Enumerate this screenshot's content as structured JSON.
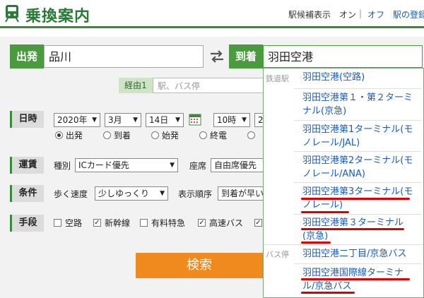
{
  "header": {
    "title": "乗換案内",
    "station_candidates_label": "駅候補表示",
    "on": "オン",
    "sep": "|",
    "off": "オフ",
    "register_link": "駅の登録"
  },
  "stations": {
    "from_label": "出発",
    "from_value": "品川",
    "to_label": "到着",
    "to_value": "羽田空港",
    "via_label": "経由1",
    "via_placeholder": "駅、バス停"
  },
  "datetime": {
    "label": "日時",
    "year": "2020年",
    "month": "3月",
    "day": "14日",
    "hour": "10時",
    "minute_partial": "2",
    "options": [
      "出発",
      "到着",
      "始発",
      "終電"
    ],
    "selected": "出発"
  },
  "fare": {
    "label": "運賃",
    "type_label": "種別",
    "type_value": "ICカード優先",
    "seat_label": "座席",
    "seat_value": "自由席優先"
  },
  "conditions": {
    "label": "条件",
    "walk_label": "歩く速度",
    "walk_value": "少しゆっくり",
    "order_label": "表示順序",
    "order_value": "到着が早い"
  },
  "means": {
    "label": "手段",
    "items": [
      {
        "label": "空路",
        "checked": false
      },
      {
        "label": "新幹線",
        "checked": true
      },
      {
        "label": "有料特急",
        "checked": false
      },
      {
        "label": "高速バス",
        "checked": true
      }
    ]
  },
  "search_button": "検索",
  "dropdown": {
    "rail_category": "鉄道駅",
    "bus_category": "バス停",
    "rail_items": [
      {
        "line1": "羽田空港(空路)",
        "line2": ""
      },
      {
        "line1": "羽田空港第１・第２ターミ",
        "line2": "ナル(京急)"
      },
      {
        "line1": "羽田空港第1ターミナル(モ",
        "line2": "ノレール/JAL)"
      },
      {
        "line1": "羽田空港第2ターミナル(モ",
        "line2": "ノレール/ANA)"
      },
      {
        "line1": "羽田空港第3ターミナル(モ",
        "line2": "ノレール)"
      },
      {
        "line1": "羽田空港第３ターミナル",
        "line2": "(京急)"
      }
    ],
    "bus_items": [
      {
        "line1": "羽田空港二丁目/京急バス",
        "line2": ""
      },
      {
        "line1": "羽田空港国際線ターミナ",
        "line2": "ル/京急バス"
      }
    ]
  },
  "colors": {
    "brand_green": "#4a9a3e",
    "link_blue": "#1a5bb8",
    "search_orange": "#f08a1e",
    "annotation_red": "#dd0000"
  }
}
